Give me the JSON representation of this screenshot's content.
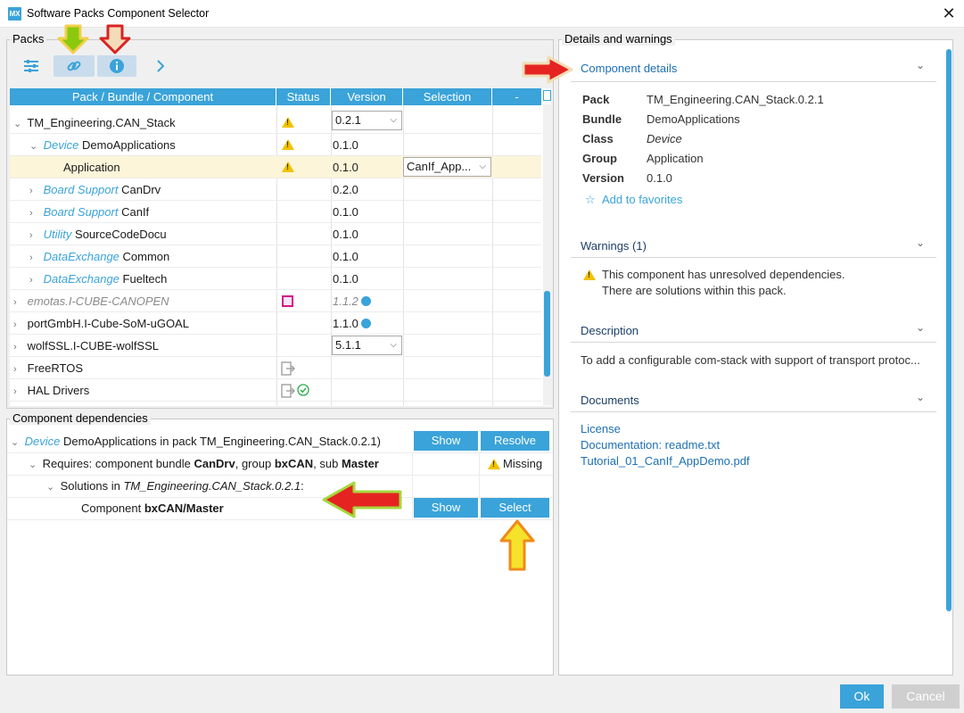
{
  "window": {
    "title": "Software Packs Component Selector",
    "logo": "MX",
    "close_glyph": "✕"
  },
  "packs": {
    "group_label": "Packs",
    "columns": [
      "Pack / Bundle / Component",
      "Status",
      "Version",
      "Selection",
      "-"
    ],
    "rows": [
      {
        "name_plain": "TM_Engineering.CAN_Stack",
        "version": "0.2.1"
      },
      {
        "cat": "Device",
        "name": "DemoApplications",
        "version": "0.1.0"
      },
      {
        "name_plain": "Application",
        "version": "0.1.0",
        "selection": "CanIf_App..."
      },
      {
        "cat": "Board Support",
        "name": "CanDrv",
        "version": "0.2.0"
      },
      {
        "cat": "Board Support",
        "name": "CanIf",
        "version": "0.1.0"
      },
      {
        "cat": "Utility",
        "name": "SourceCodeDocu",
        "version": "0.1.0"
      },
      {
        "cat": "DataExchange",
        "name": "Common",
        "version": "0.1.0"
      },
      {
        "cat": "DataExchange",
        "name": "Fueltech",
        "version": "0.1.0"
      },
      {
        "name_plain": "emotas.I-CUBE-CANOPEN",
        "version": "1.1.2"
      },
      {
        "name_plain": "portGmbH.I-Cube-SoM-uGOAL",
        "version": "1.1.0"
      },
      {
        "name_plain": "wolfSSL.I-CUBE-wolfSSL",
        "version": "5.1.1"
      },
      {
        "name_plain": "FreeRTOS"
      },
      {
        "name_plain": "HAL Drivers"
      }
    ]
  },
  "deps": {
    "group_label": "Component dependencies",
    "r1_cat": "Device",
    "r1_text": " DemoApplications in pack TM_Engineering.CAN_Stack.0.2.1)",
    "show": "Show",
    "resolve": "Resolve",
    "r2_prefix": "Requires: component bundle ",
    "r2_bundle": "CanDrv",
    "r2_mid1": ", group ",
    "r2_group": "bxCAN",
    "r2_mid2": ", sub ",
    "r2_sub": "Master",
    "missing": "Missing",
    "r3_prefix": "Solutions in ",
    "r3_pack": "TM_Engineering.CAN_Stack.0.2.1",
    "r3_suffix": ":",
    "r4_prefix": "Component ",
    "r4_comp": "bxCAN/Master",
    "select": "Select"
  },
  "details": {
    "group_label": "Details and warnings",
    "component_details": "Component details",
    "kv": {
      "pack_k": "Pack",
      "pack_v": "TM_Engineering.CAN_Stack.0.2.1",
      "bundle_k": "Bundle",
      "bundle_v": "DemoApplications",
      "class_k": "Class",
      "class_v": "Device",
      "group_k": "Group",
      "group_v": "Application",
      "version_k": "Version",
      "version_v": "0.1.0"
    },
    "favorites": "Add to favorites",
    "warnings_title": "Warnings (1)",
    "warn_line1": "This component has unresolved dependencies.",
    "warn_line2": "There are solutions within this pack.",
    "description_title": "Description",
    "description_text": "To add a configurable com-stack with support of transport protoc...",
    "documents_title": "Documents",
    "docs": [
      "License",
      "Documentation: readme.txt",
      "Tutorial_01_CanIf_AppDemo.pdf"
    ]
  },
  "footer": {
    "ok": "Ok",
    "cancel": "Cancel"
  },
  "colors": {
    "accent": "#3aa3d9",
    "link": "#1c6fb5",
    "warning": "#f2c200",
    "selected_row": "#fdf5d9"
  }
}
